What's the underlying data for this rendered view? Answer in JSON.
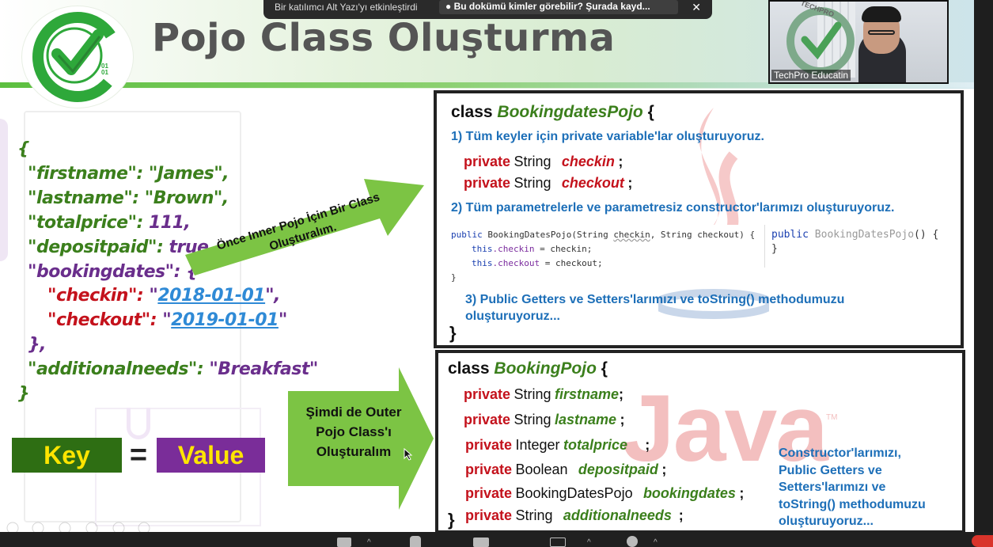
{
  "slide": {
    "title": "Pojo Class Oluşturma",
    "logo_text": "01 01",
    "json_sample": {
      "open": "{",
      "firstname_key": "\"firstname\":",
      "firstname_val": "\"James\",",
      "lastname_key": "\"lastname\":",
      "lastname_val": "\"Brown\",",
      "totalprice_key": "\"totalprice\":",
      "totalprice_val": "111,",
      "depositpaid_key": "\"depositpaid\":",
      "depositpaid_val": "true,",
      "bookingdates_key": "\"bookingdates\":",
      "bookingdates_open": "{",
      "checkin_key": "\"checkin\":",
      "checkin_q1": "\"",
      "checkin_val": "2018-01-01",
      "checkin_q2": "\",",
      "checkout_key": "\"checkout\":",
      "checkout_q1": "\"",
      "checkout_val": "2019-01-01",
      "checkout_q2": "\"",
      "inner_close": "},",
      "additionalneeds_key": "\"additionalneeds\":",
      "additionalneeds_val": "\"Breakfast\"",
      "close": "}"
    },
    "key_label": "Key",
    "equals": "=",
    "value_label": "Value",
    "arrow1_text": "Önce Inner Pojo İçin Bir Class Oluşturalım.",
    "arrow2_text": "Şimdi de Outer Pojo Class'ı Oluşturalım",
    "booking_dates": {
      "class_kw": "class",
      "class_name": "BookingdatesPojo",
      "brace_open": "{",
      "step1": "1) Tüm keyler için private variable'lar oluşturuyoruz.",
      "fields": [
        {
          "mod": "private",
          "type": "String",
          "name": "checkin",
          "semi": ";"
        },
        {
          "mod": "private",
          "type": "String",
          "name": "checkout",
          "semi": ";"
        }
      ],
      "step2": "2) Tüm parametrelerle ve parametresiz constructor'larımızı oluşturuyoruz.",
      "code1": {
        "line1a": "public",
        "line1b": " BookingDatesPojo(String ",
        "line1c": "checkin",
        "line1d": ", String checkout) {",
        "line2a": "this",
        "line2b": ".checkin",
        "line2c": " = checkin;",
        "line3a": "this",
        "line3b": ".checkout",
        "line3c": " = checkout;",
        "line4": "}"
      },
      "code2": {
        "line1a": "public",
        "line1b": " BookingDatesPojo",
        "line1c": "() {",
        "line2": "}"
      },
      "step3_line1": "3) Public Getters ve Setters'larımızı ve toString() methodumuzu",
      "step3_line2": "oluşturuyoruz...",
      "brace_close": "}"
    },
    "booking": {
      "class_kw": "class",
      "class_name": "BookingPojo",
      "brace_open": "{",
      "fields": [
        {
          "mod": "private",
          "type": "String",
          "name": "firstname",
          "semi": ";"
        },
        {
          "mod": "private",
          "type": "String",
          "name": "lastname",
          "semi": ";"
        },
        {
          "mod": "private",
          "type": "Integer",
          "name": "totalprice",
          "semi": ";"
        },
        {
          "mod": "private",
          "type": "Boolean",
          "name": "depositpaid",
          "semi": ";"
        },
        {
          "mod": "private",
          "type": "BookingDatesPojo",
          "name": "bookingdates",
          "semi": ";"
        },
        {
          "mod": "private",
          "type": "String",
          "name": "additionalneeds",
          "semi": ";"
        }
      ],
      "brace_close": "}",
      "note_lines": [
        "Constructor'larımızı,",
        "Public Getters ve",
        "Setters'larımızı ve",
        "toString() methodumuzu",
        "oluşturuyoruz..."
      ],
      "watermark": "Java",
      "watermark_tm": "TM"
    }
  },
  "notification": {
    "text": "Bir katılımcı Alt Yazı'yı etkinleştirdi",
    "highlight": "Bu dokümü kimler görebilir? Şurada kayd...",
    "close": "✕"
  },
  "camera": {
    "label": "TechPro Educatin",
    "logo_text": "TECHPRO"
  },
  "colors": {
    "green": "#3b7f1c",
    "purple": "#6a2e8c",
    "red": "#c4121c",
    "blue": "#1d6fb8",
    "arrow": "#7cc444"
  }
}
